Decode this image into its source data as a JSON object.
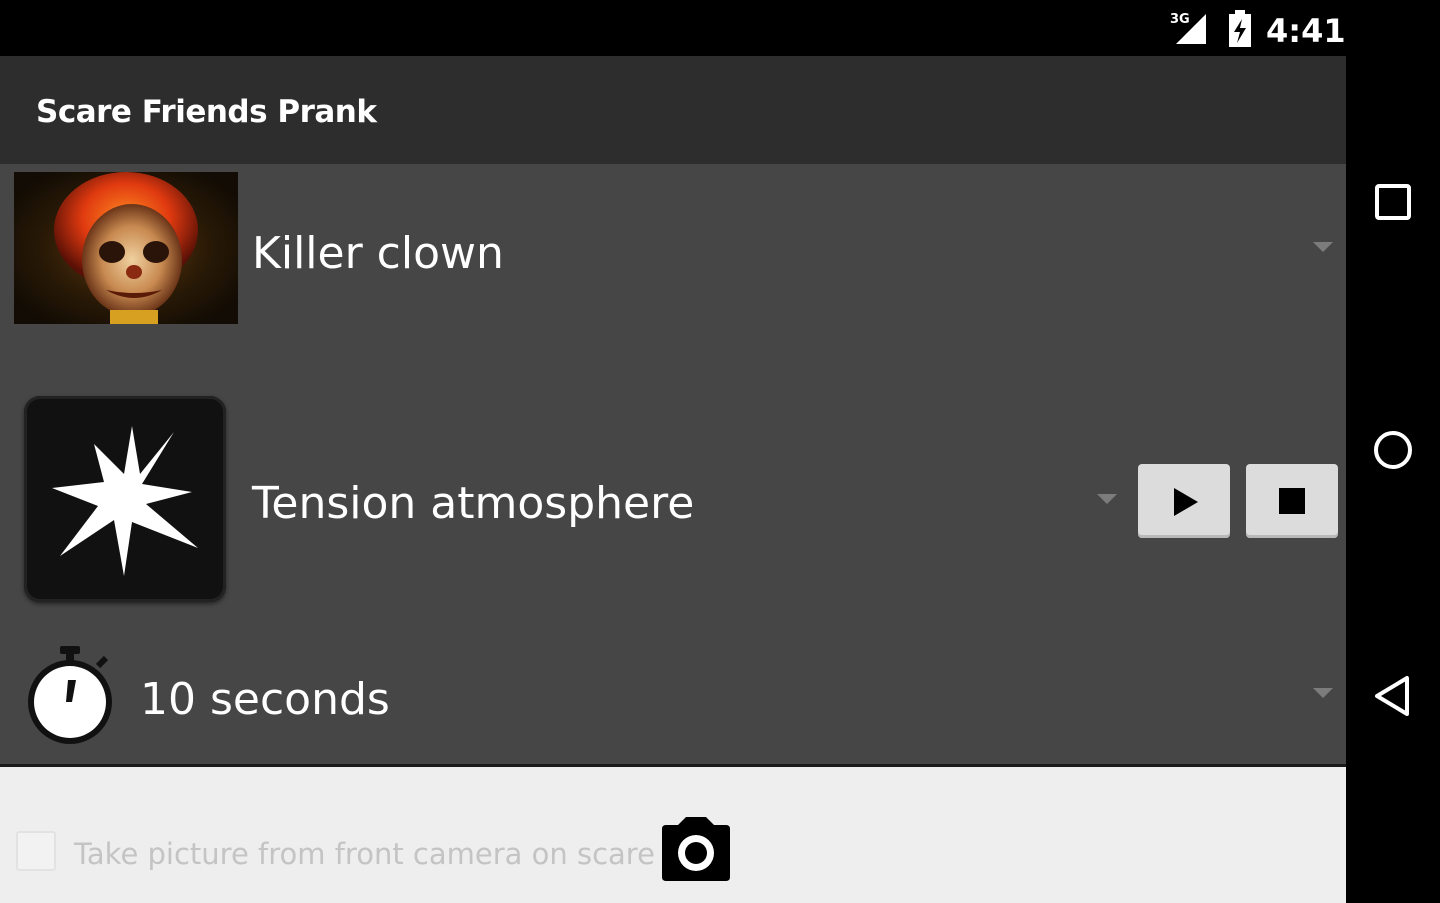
{
  "status_bar": {
    "network_type": "3G",
    "time": "4:41",
    "icons": [
      "signal-icon",
      "battery-icon"
    ]
  },
  "app_bar": {
    "title": "Scare Friends Prank"
  },
  "scare_selector": {
    "image_icon": "killer-clown-image",
    "selected": "Killer clown"
  },
  "sound_selector": {
    "image_icon": "explosion-icon",
    "selected": "Tension atmosphere",
    "play_icon": "play-icon",
    "stop_icon": "stop-icon"
  },
  "timer_selector": {
    "icon": "stopwatch-icon",
    "selected": "10 seconds"
  },
  "photo_option": {
    "label": "Take picture from front camera on scare",
    "checked": false,
    "icon": "camera-icon"
  },
  "nav_bar": {
    "icons": [
      "recent-apps-icon",
      "home-icon",
      "back-icon"
    ]
  },
  "colors": {
    "app_background": "#464646",
    "action_bar": "#2d2d2d",
    "panel_background": "#eeeeee",
    "button_background": "#dcdcdc"
  }
}
